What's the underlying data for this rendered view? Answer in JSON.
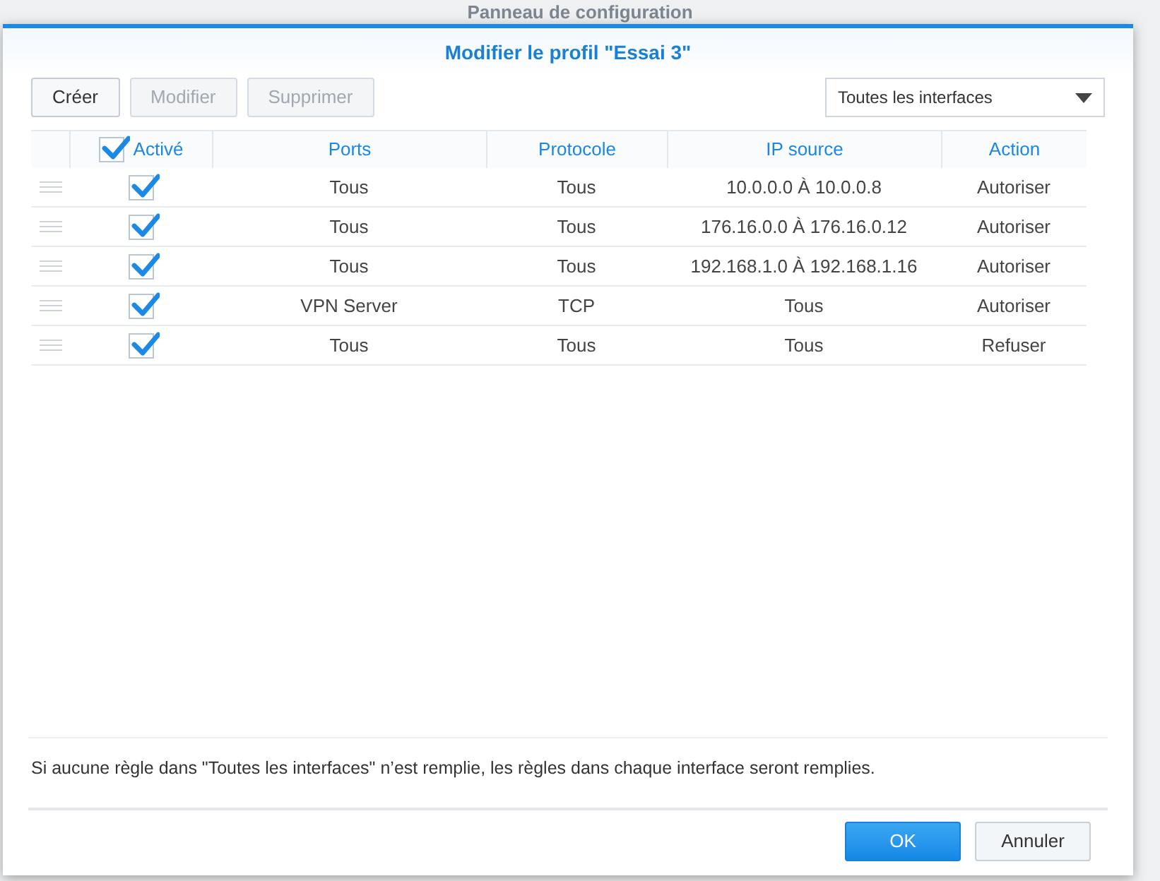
{
  "background_window": {
    "title": "Panneau de configuration"
  },
  "dialog": {
    "title": "Modifier le profil \"Essai 3\""
  },
  "toolbar": {
    "buttons": [
      {
        "label": "Créer",
        "disabled": false
      },
      {
        "label": "Modifier",
        "disabled": true
      },
      {
        "label": "Supprimer",
        "disabled": true
      }
    ],
    "interface_select": {
      "value": "Toutes les interfaces"
    }
  },
  "table": {
    "header_checked": true,
    "columns": [
      "Activé",
      "Ports",
      "Protocole",
      "IP source",
      "Action"
    ],
    "rows": [
      {
        "enabled": true,
        "ports": "Tous",
        "protocol": "Tous",
        "source_ip": "10.0.0.0 À 10.0.0.8",
        "action": "Autoriser"
      },
      {
        "enabled": true,
        "ports": "Tous",
        "protocol": "Tous",
        "source_ip": "176.16.0.0 À 176.16.0.12",
        "action": "Autoriser"
      },
      {
        "enabled": true,
        "ports": "Tous",
        "protocol": "Tous",
        "source_ip": "192.168.1.0 À 192.168.1.16",
        "action": "Autoriser"
      },
      {
        "enabled": true,
        "ports": "VPN Server",
        "protocol": "TCP",
        "source_ip": "Tous",
        "action": "Autoriser"
      },
      {
        "enabled": true,
        "ports": "Tous",
        "protocol": "Tous",
        "source_ip": "Tous",
        "action": "Refuser"
      }
    ]
  },
  "note": "Si aucune règle dans \"Toutes les interfaces\" n’est remplie, les règles dans chaque interface seront remplies.",
  "footer": {
    "ok": "OK",
    "cancel": "Annuler"
  }
}
